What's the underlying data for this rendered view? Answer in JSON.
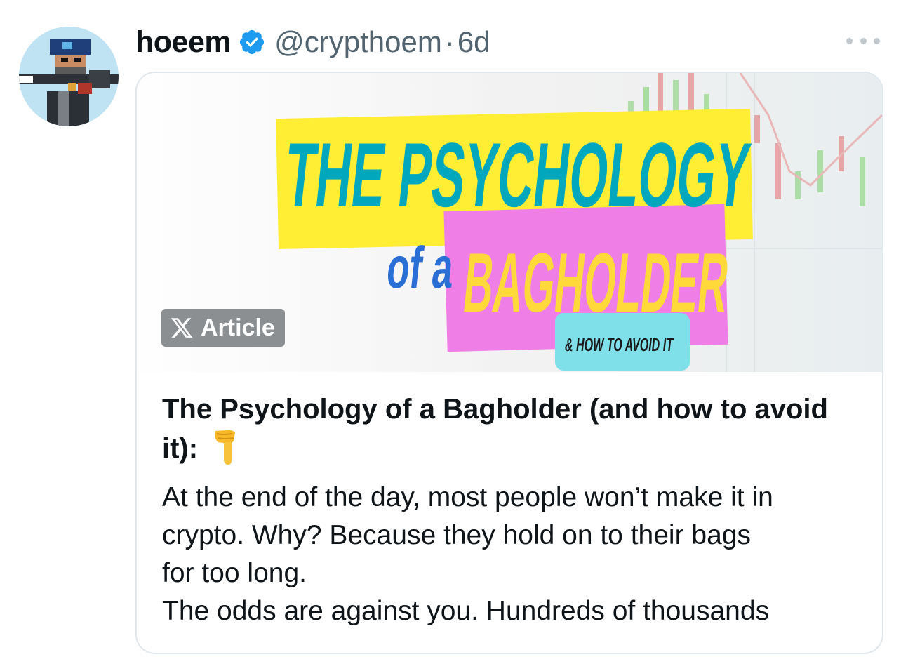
{
  "tweet": {
    "display_name": "hoeem",
    "handle": "@crypthoem",
    "separator": "·",
    "time": "6d",
    "avatar_icon": "pixel-art-character-avatar",
    "verified_icon": "verified-badge-icon",
    "more_icon": "more-options-icon"
  },
  "article": {
    "badge_label": "Article",
    "badge_icon": "x-logo-icon",
    "cover": {
      "line1": "THE PSYCHOLOGY",
      "line2_small": "of a",
      "line2_big": "BAGHOLDER",
      "line3": "& HOW TO AVOID IT"
    },
    "title": "The Psychology of a Bagholder (and how to avoid it):",
    "title_emoji": "backhand-index-pointing-down-emoji",
    "preview_lines": [
      "At the end of the day, most people won’t make it in",
      "crypto. Why? Because they hold on to their bags",
      "for too long.",
      "The odds are against you. Hundreds of thousands"
    ]
  },
  "colors": {
    "verified_blue": "#1d9bf0",
    "cover_yellow": "#ffee33",
    "cover_pink": "#ef7fe6",
    "cover_teal": "#00a7bd",
    "cover_cyan_pill": "#7fe0ea",
    "badge_gray": "#8b8f92"
  }
}
